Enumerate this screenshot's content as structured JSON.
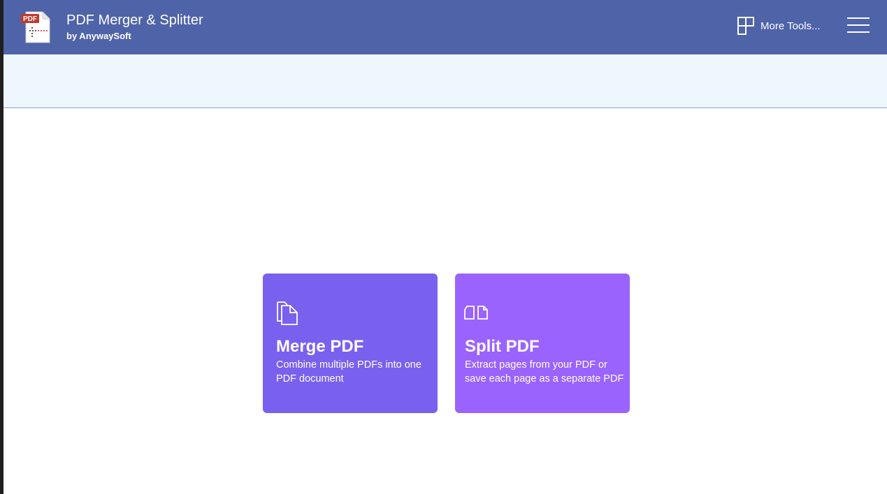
{
  "header": {
    "title": "PDF Merger & Splitter",
    "subtitle": "by AnywaySoft",
    "logo_text": "PDF",
    "more_tools_label": "More Tools...",
    "background_color": "#4f63a8"
  },
  "icons": {
    "app_logo": "pdf-file-icon",
    "more_tools": "window-grid-icon",
    "menu": "hamburger-menu-icon",
    "merge": "copy-pages-icon",
    "split": "split-pages-icon"
  },
  "cards": {
    "merge": {
      "title": "Merge PDF",
      "description": "Combine multiple PDFs into one PDF document",
      "color": "#7a60ee"
    },
    "split": {
      "title": "Split PDF",
      "description": "Extract pages from your PDF or save each page as a separate PDF",
      "color": "#9a63fd"
    }
  }
}
